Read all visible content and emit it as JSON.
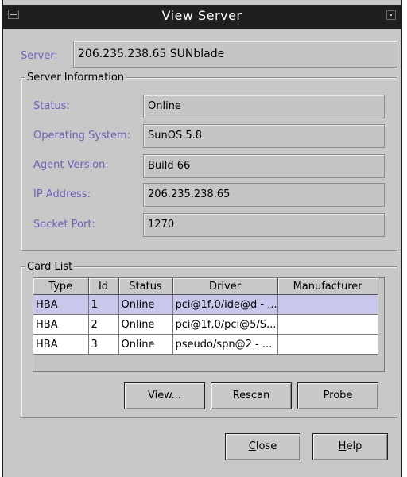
{
  "window": {
    "title": "View Server"
  },
  "server": {
    "label": "Server:",
    "value": "206.235.238.65 SUNblade"
  },
  "server_info": {
    "group_title": "Server Information",
    "fields": [
      {
        "label": "Status:",
        "value": "Online"
      },
      {
        "label": "Operating System:",
        "value": "SunOS 5.8"
      },
      {
        "label": "Agent Version:",
        "value": "Build 66"
      },
      {
        "label": "IP Address:",
        "value": "206.235.238.65"
      },
      {
        "label": "Socket Port:",
        "value": "1270"
      }
    ]
  },
  "card_list": {
    "group_title": "Card List",
    "columns": [
      "Type",
      "Id",
      "Status",
      "Driver",
      "Manufacturer"
    ],
    "rows": [
      [
        "HBA",
        "1",
        "Online",
        "pci@1f,0/ide@d - ...",
        ""
      ],
      [
        "HBA",
        "2",
        "Online",
        "pci@1f,0/pci@5/S...",
        ""
      ],
      [
        "HBA",
        "3",
        "Online",
        "pseudo/spn@2 - ...",
        ""
      ]
    ],
    "selected_row": 0,
    "buttons": {
      "view": "View...",
      "rescan": "Rescan",
      "probe": "Probe"
    }
  },
  "footer": {
    "close": {
      "mnemonic": "C",
      "rest": "lose"
    },
    "help": {
      "mnemonic": "H",
      "rest": "elp"
    }
  },
  "colors": {
    "label_blue": "#6b64b8",
    "selection": "#c9c8ec",
    "titlebar": "#1f1f1f"
  }
}
